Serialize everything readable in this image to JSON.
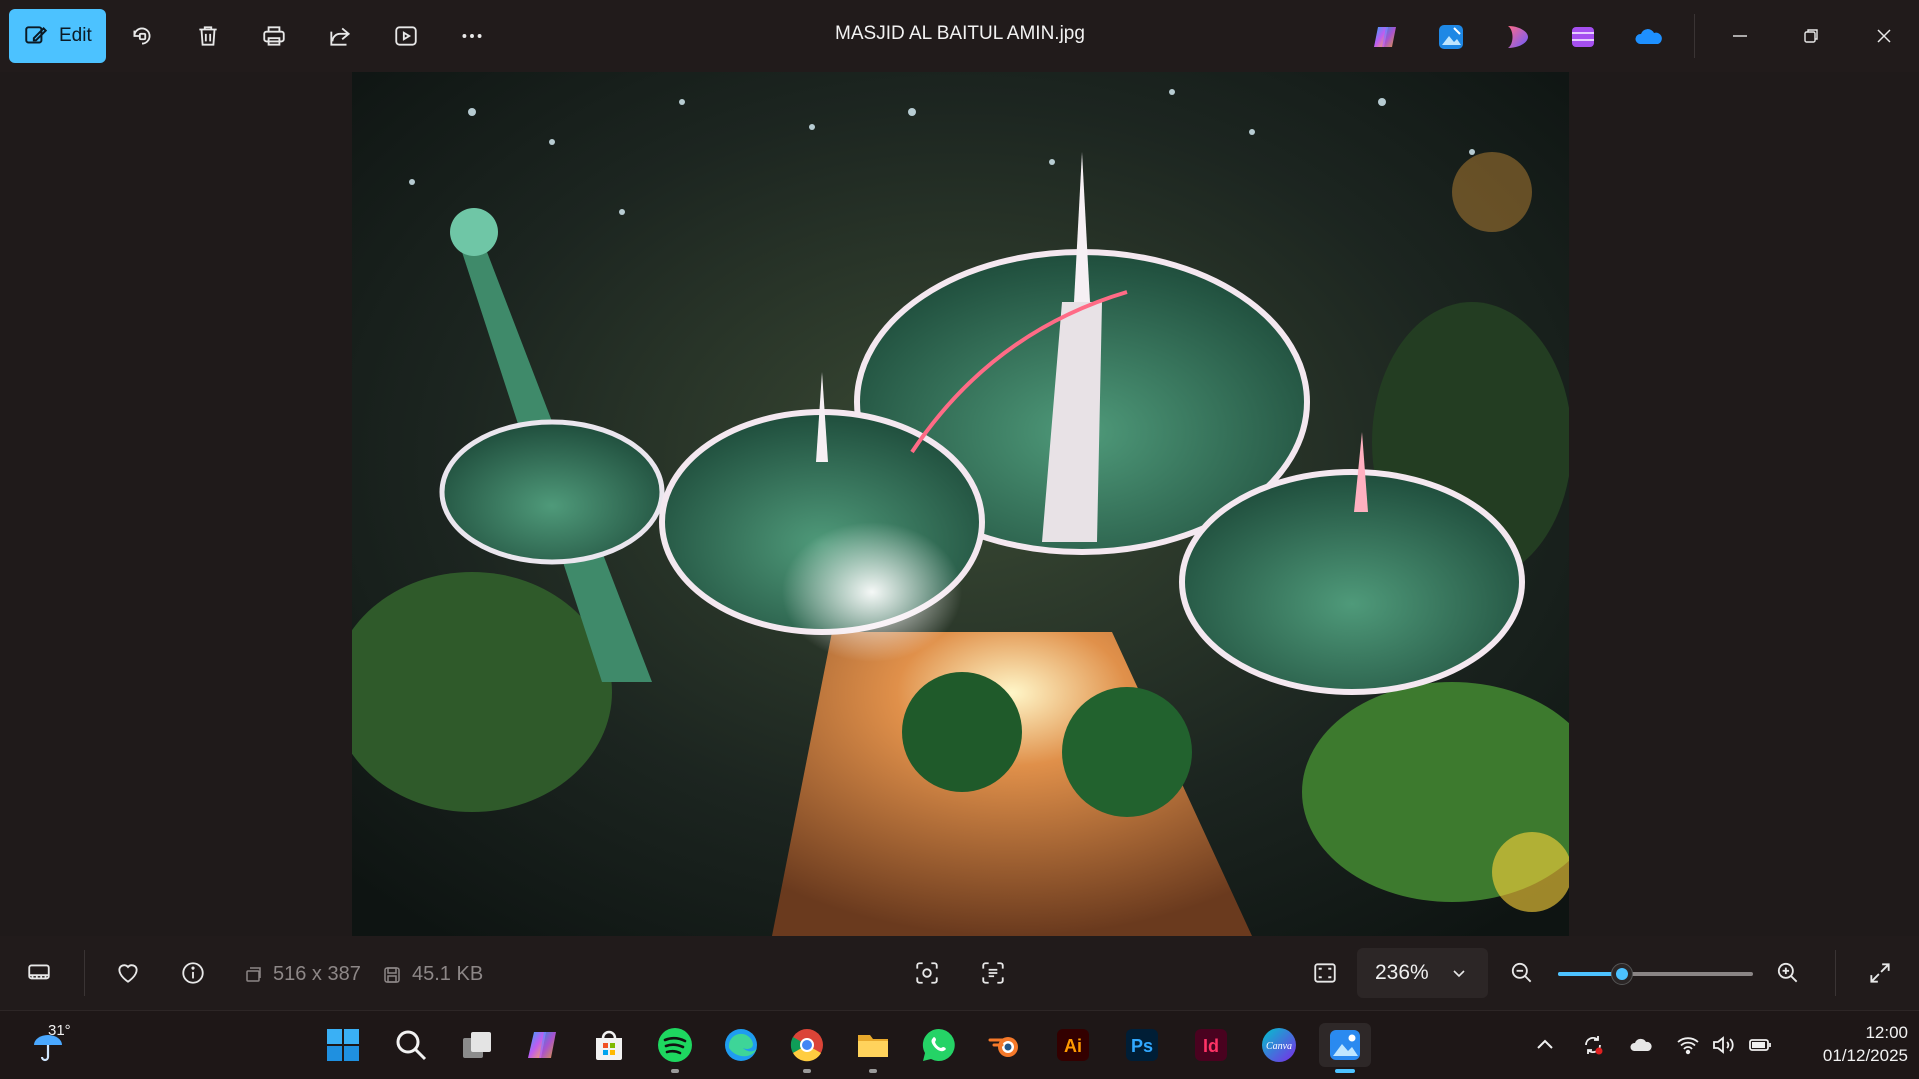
{
  "titlebar": {
    "edit_label": "Edit",
    "file_name": "MASJID AL BAITUL AMIN.jpg",
    "toolbar_icons": [
      "edit-icon",
      "rotate-icon",
      "delete-icon",
      "print-icon",
      "share-icon",
      "slideshow-icon",
      "more-icon"
    ],
    "app_shortcuts": [
      "copilot-icon",
      "photos-editor-icon",
      "designer-icon",
      "clipchamp-icon",
      "onedrive-icon"
    ],
    "window_controls": [
      "minimize-icon",
      "restore-icon",
      "close-icon"
    ]
  },
  "image": {
    "alt": "MASJID AL BAITUL AMIN.jpg"
  },
  "bottombar": {
    "dimensions": "516 x 387",
    "file_size": "45.1 KB",
    "zoom_value": "236%",
    "zoom_slider_fraction": 0.33,
    "icons": [
      "filmstrip-icon",
      "favorite-icon",
      "info-icon",
      "visual-search-icon",
      "text-extract-icon",
      "fit-window-icon",
      "zoom-out-icon",
      "zoom-in-icon",
      "fullscreen-icon"
    ]
  },
  "taskbar": {
    "weather_temp": "31°",
    "apps": [
      {
        "name": "start",
        "icon": "windows-icon"
      },
      {
        "name": "search",
        "icon": "search-icon"
      },
      {
        "name": "task-view",
        "icon": "task-view-icon"
      },
      {
        "name": "copilot",
        "icon": "copilot-icon"
      },
      {
        "name": "store",
        "icon": "store-icon"
      },
      {
        "name": "spotify",
        "icon": "spotify-icon",
        "running": true
      },
      {
        "name": "edge",
        "icon": "edge-icon"
      },
      {
        "name": "chrome",
        "icon": "chrome-icon",
        "running": true
      },
      {
        "name": "file-explorer",
        "icon": "folder-icon",
        "running": true
      },
      {
        "name": "whatsapp",
        "icon": "whatsapp-icon"
      },
      {
        "name": "blender",
        "icon": "blender-icon"
      },
      {
        "name": "illustrator",
        "icon": "illustrator-icon",
        "label": "Ai"
      },
      {
        "name": "photoshop",
        "icon": "photoshop-icon",
        "label": "Ps"
      },
      {
        "name": "indesign",
        "icon": "indesign-icon",
        "label": "Id"
      },
      {
        "name": "canva",
        "icon": "canva-icon",
        "label": "Canva"
      },
      {
        "name": "photos",
        "icon": "photos-icon",
        "active": true
      }
    ],
    "time": "12:00",
    "date": "01/12/2025"
  },
  "colors": {
    "accent": "#4cc2ff",
    "titlebar_bg": "#211b1b",
    "taskbar_bg": "#1e1717"
  }
}
